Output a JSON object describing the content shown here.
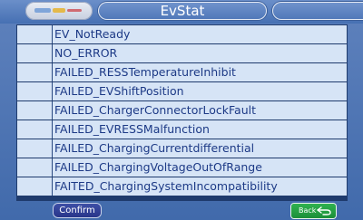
{
  "header": {
    "title": "EvStat"
  },
  "list": {
    "items": [
      {
        "label": "EV_NotReady"
      },
      {
        "label": "NO_ERROR"
      },
      {
        "label": "FAILED_RESSTemperatureInhibit"
      },
      {
        "label": "FAILED_EVShiftPosition"
      },
      {
        "label": "FAILED_ChargerConnectorLockFault"
      },
      {
        "label": "FAILED_EVRESSMalfunction"
      },
      {
        "label": "FAILED_ChargingCurrentdifferential"
      },
      {
        "label": "FAILED_ChargingVoltageOutOfRange"
      },
      {
        "label": "FAITED_ChargingSystemIncompatibility"
      }
    ]
  },
  "footer": {
    "confirm_label": "Confirm",
    "back_label": "Back",
    "back_icon": "return-arrow-icon"
  },
  "colors": {
    "background": "#4a72b4",
    "row_fill": "#d6e4f6",
    "row_text": "#1d3a86",
    "confirm_button": "#2f3d95",
    "back_button": "#22a043"
  }
}
